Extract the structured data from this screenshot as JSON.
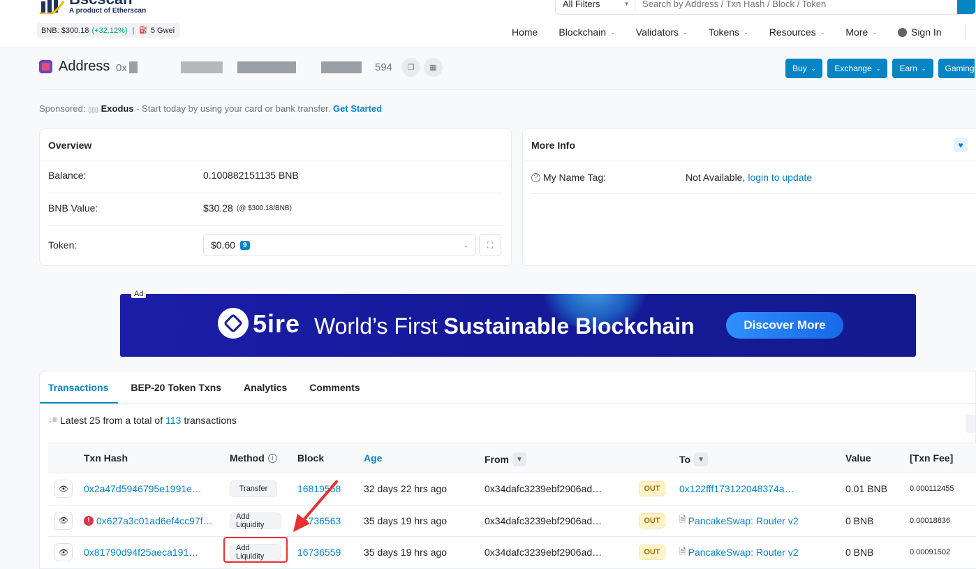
{
  "header": {
    "logo_name": "Bscscan",
    "logo_sub": "A product of Etherscan",
    "bnb_price": "BNB: $300.18",
    "bnb_change": "(+32.12%)",
    "gas": "5 Gwei",
    "search_filter": "All Filters",
    "search_placeholder": "Search by Address / Txn Hash / Block / Token",
    "nav": {
      "home": "Home",
      "blockchain": "Blockchain",
      "validators": "Validators",
      "tokens": "Tokens",
      "resources": "Resources",
      "more": "More",
      "sign_in": "Sign In"
    }
  },
  "address": {
    "title": "Address",
    "hash_prefix": "0x",
    "hash_suffix": "594",
    "actions": {
      "buy": "Buy",
      "exchange": "Exchange",
      "earn": "Earn",
      "gaming": "Gaming"
    }
  },
  "sponsor": {
    "prefix": "Sponsored:",
    "brand": "Exodus",
    "text": "- Start today by using your card or bank transfer.",
    "cta": "Get Started"
  },
  "overview": {
    "title": "Overview",
    "balance_label": "Balance:",
    "balance_value": "0.100882151135 BNB",
    "value_label": "BNB Value:",
    "value_amount": "$30.28",
    "value_rate": "(@ $300.18/BNB)",
    "token_label": "Token:",
    "token_value": "$0.60",
    "token_count": "9"
  },
  "more_info": {
    "title": "More Info",
    "name_tag_label": "My Name Tag:",
    "name_tag_value": "Not Available,",
    "name_tag_link": "login to update"
  },
  "ad": {
    "label": "Ad",
    "brand": "5ire",
    "text_plain": "World’s First",
    "text_bold": "Sustainable Blockchain",
    "cta": "Discover More"
  },
  "transactions": {
    "tabs": [
      "Transactions",
      "BEP-20 Token Txns",
      "Analytics",
      "Comments"
    ],
    "summary_prefix": "Latest 25 from a total of",
    "summary_count": "113",
    "summary_suffix": "transactions",
    "columns": {
      "hash": "Txn Hash",
      "method": "Method",
      "block": "Block",
      "age": "Age",
      "from": "From",
      "to": "To",
      "value": "Value",
      "fee": "[Txn Fee]"
    },
    "rows": [
      {
        "hash": "0x2a47d5946795e1991e…",
        "method": "Transfer",
        "block": "16819558",
        "age": "32 days 22 hrs ago",
        "from": "0x34dafc3239ebf2906ad…",
        "direction": "OUT",
        "to": "0x122fff173122048374a…",
        "value": "0.01 BNB",
        "fee": "0.000112455"
      },
      {
        "hash": "0x627a3c01ad6ef4cc97f…",
        "method": "Add Liquidity",
        "block": "16736563",
        "age": "35 days 19 hrs ago",
        "from": "0x34dafc3239ebf2906ad…",
        "direction": "OUT",
        "to": "PancakeSwap: Router v2",
        "value": "0 BNB",
        "fee": "0.00018836"
      },
      {
        "hash": "0x81790d94f25aeca191…",
        "method": "Add Liquidity",
        "block": "16736559",
        "age": "35 days 19 hrs ago",
        "from": "0x34dafc3239ebf2906ad…",
        "direction": "OUT",
        "to": "PancakeSwap: Router v2",
        "value": "0 BNB",
        "fee": "0.00091502"
      }
    ]
  },
  "colors": {
    "accent": "#0784c3",
    "positive": "#00a186",
    "annotation": "#e8302e"
  }
}
